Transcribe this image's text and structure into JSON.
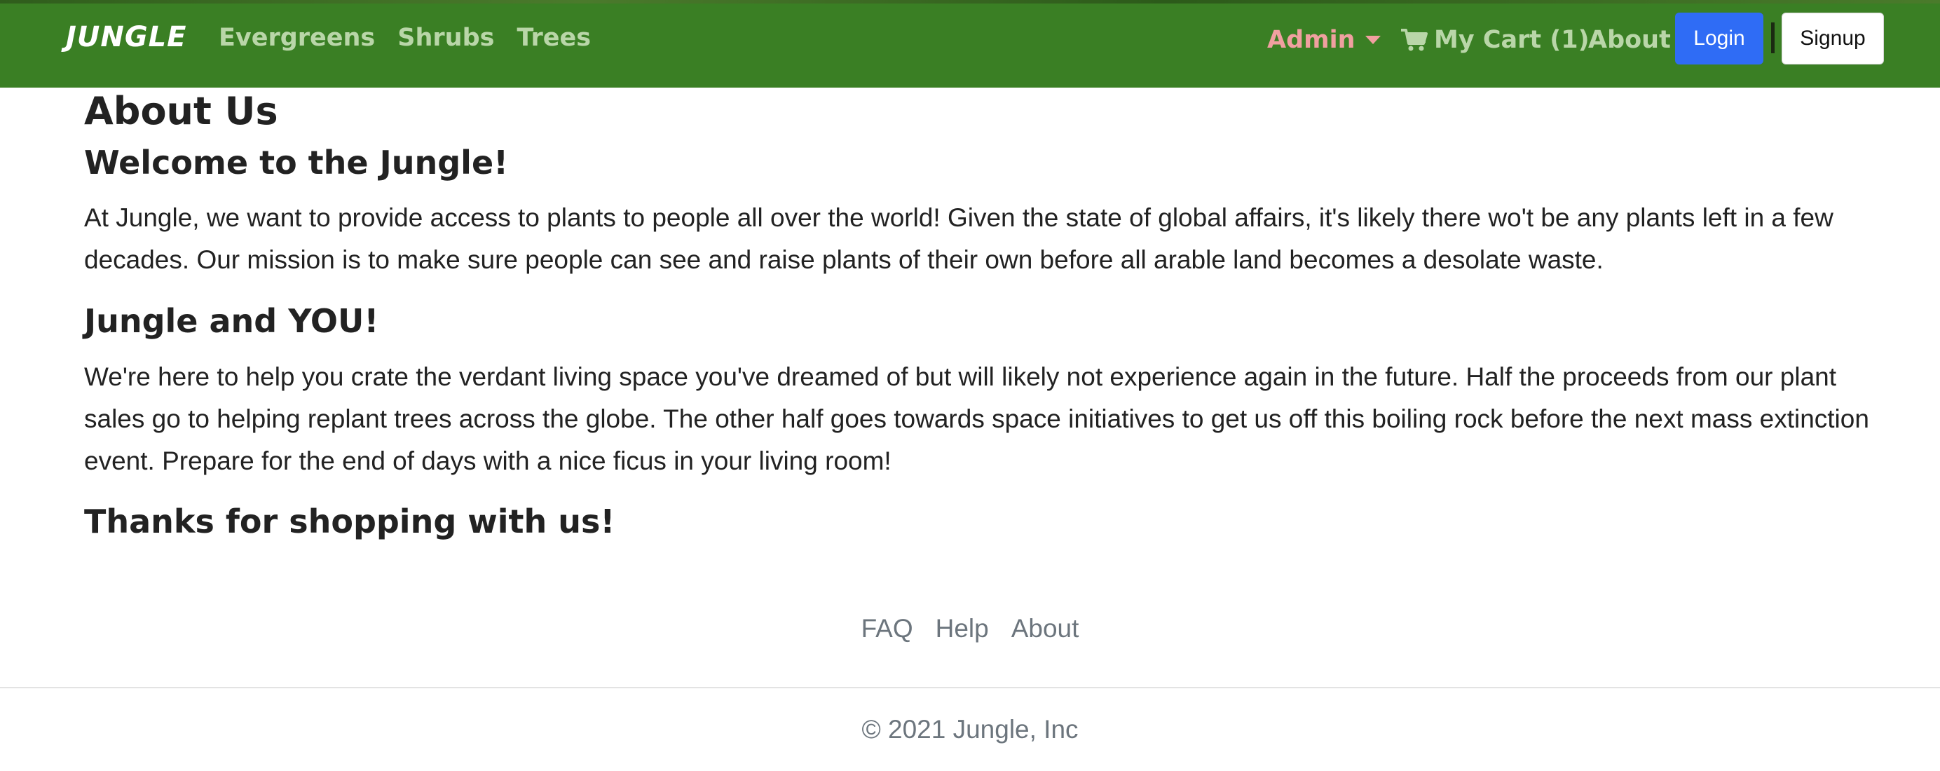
{
  "nav": {
    "brand": "JUNGLE",
    "links": [
      "Evergreens",
      "Shrubs",
      "Trees"
    ],
    "admin_label": "Admin",
    "cart_label": "My Cart (1)",
    "about_label": "About",
    "login_label": "Login",
    "signup_label": "Signup"
  },
  "main": {
    "title": "About Us",
    "sections": [
      {
        "heading": "Welcome to the Jungle!",
        "paragraph": "At Jungle, we want to provide access to plants to people all over the world! Given the state of global affairs, it's likely there wo't be any plants left in a few decades. Our mission is to make sure people can see and raise plants of their own before all arable land becomes a desolate waste."
      },
      {
        "heading": "Jungle and YOU!",
        "paragraph": "We're here to help you crate the verdant living space you've dreamed of but will likely not experience again in the future. Half the proceeds from our plant sales go to helping replant trees across the globe. The other half goes towards space initiatives to get us off this boiling rock before the next mass extinction event. Prepare for the end of days with a nice ficus in your living room!"
      }
    ],
    "closing": "Thanks for shopping with us!"
  },
  "footer": {
    "links": [
      "FAQ",
      "Help",
      "About"
    ],
    "copyright": "© 2021 Jungle, Inc"
  },
  "colors": {
    "navbar": "#3a7f24",
    "nav_link": "#b9d6a8",
    "admin": "#f0a0a0",
    "login_button": "#2f6cf5"
  },
  "icons": {
    "cart": "shopping-cart-icon",
    "admin_dropdown": "caret-down-icon"
  }
}
